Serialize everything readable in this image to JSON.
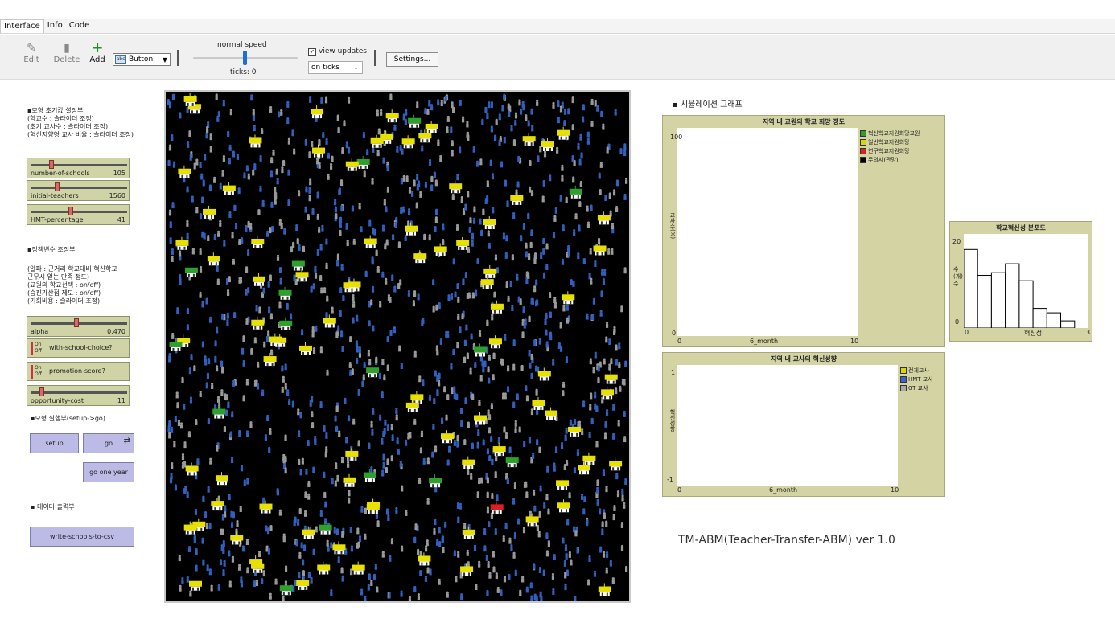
{
  "tabs": [
    "Interface",
    "Info",
    "Code"
  ],
  "toolbar": {
    "edit": "Edit",
    "delete": "Delete",
    "add": "Add",
    "widget_type": "Button",
    "widget_icon_text": "abc",
    "speed_label": "normal speed",
    "ticks_label": "ticks: 0",
    "view_updates_label": "view updates",
    "view_updates_checked": true,
    "update_mode": "on ticks",
    "settings": "Settings..."
  },
  "left": {
    "setup_note": "▪모형 초기값 설정부\n(학교수 : 슬라이더 조정)\n(초기 교사수 : 슬라이더 조정)\n(혁신지향형 교사 비율 : 슬라이더 조정)",
    "sliders1": [
      {
        "name": "number-of-schools",
        "value": "105",
        "fraction": 0.2
      },
      {
        "name": "initial-teachers",
        "value": "1560",
        "fraction": 0.26
      },
      {
        "name": "HMT-percentage",
        "value": "41",
        "fraction": 0.41
      }
    ],
    "policy_title": "▪정책변수 조정부",
    "policy_note": "(알파 : 근거리 학교대비 혁신학교\n근무시 얻는 만족 정도)\n(교원의 학교선택 : on/off)\n(승진가산점 제도 : on/off)\n(기회비용 : 슬라이더 조정)",
    "alpha": {
      "name": "alpha",
      "value": "0.470",
      "fraction": 0.47
    },
    "switches": [
      {
        "name": "with-school-choice?",
        "on": "On",
        "off": "Off"
      },
      {
        "name": "promotion-score?",
        "on": "On",
        "off": "Off"
      }
    ],
    "opportunity": {
      "name": "opportunity-cost",
      "value": "11",
      "fraction": 0.1
    },
    "run_title": "▪모형 실행부(setup->go)",
    "buttons": {
      "setup": "setup",
      "go": "go",
      "go_one_year": "go one year",
      "forever_icon": "⇄"
    },
    "data_title": "▪ 데이터 출력부",
    "csv_button": "write-schools-to-csv"
  },
  "plots": {
    "section": "▪ 시뮬레이션 그래프",
    "hope": {
      "title": "지역 내 교원의 학교 희망 정도",
      "ylabel": "교사수(%)",
      "xlabel": "6_month",
      "ymin": "0",
      "ymax": "100",
      "xmin": "0",
      "xmax": "10",
      "legend": [
        {
          "label": "혁신학교지원희망교원",
          "color": "#2e9b2e"
        },
        {
          "label": "일반학교지원희망",
          "color": "#d8d800"
        },
        {
          "label": "연구학교지원희망",
          "color": "#d92020"
        },
        {
          "label": "무의사(관망)",
          "color": "#000000"
        }
      ]
    },
    "innovation": {
      "title": "지역 내 교사의 혁신성향",
      "ylabel": "혁신성향",
      "xlabel": "6_month",
      "ymin": "-1",
      "ymax": "1",
      "xmin": "0",
      "xmax": "10",
      "legend": [
        {
          "label": "전체교사",
          "color": "#d8d800"
        },
        {
          "label": "HMT 교사",
          "color": "#3a62c8"
        },
        {
          "label": "GT 교사",
          "color": "#a8a8a8"
        }
      ]
    },
    "histogram": {
      "title": "학교혁신성 분포도",
      "ylabel": "수\n(개)\n수",
      "xlabel": "혁신성",
      "ymin": "0",
      "ymax": "20",
      "xmin": "0",
      "xmax": "3",
      "bins": [
        17.6,
        11.8,
        12.4,
        14.4,
        10.6,
        4.4,
        3.4,
        1.6,
        0
      ]
    }
  },
  "version": "TM-ABM(Teacher-Transfer-ABM) ver 1.0",
  "world": {
    "background": "#000000",
    "teacher_colors": [
      "#3060c0",
      "#9a9a9a"
    ],
    "school_colors": [
      "#e8e000",
      "#2ea02e",
      "#d82020"
    ]
  }
}
